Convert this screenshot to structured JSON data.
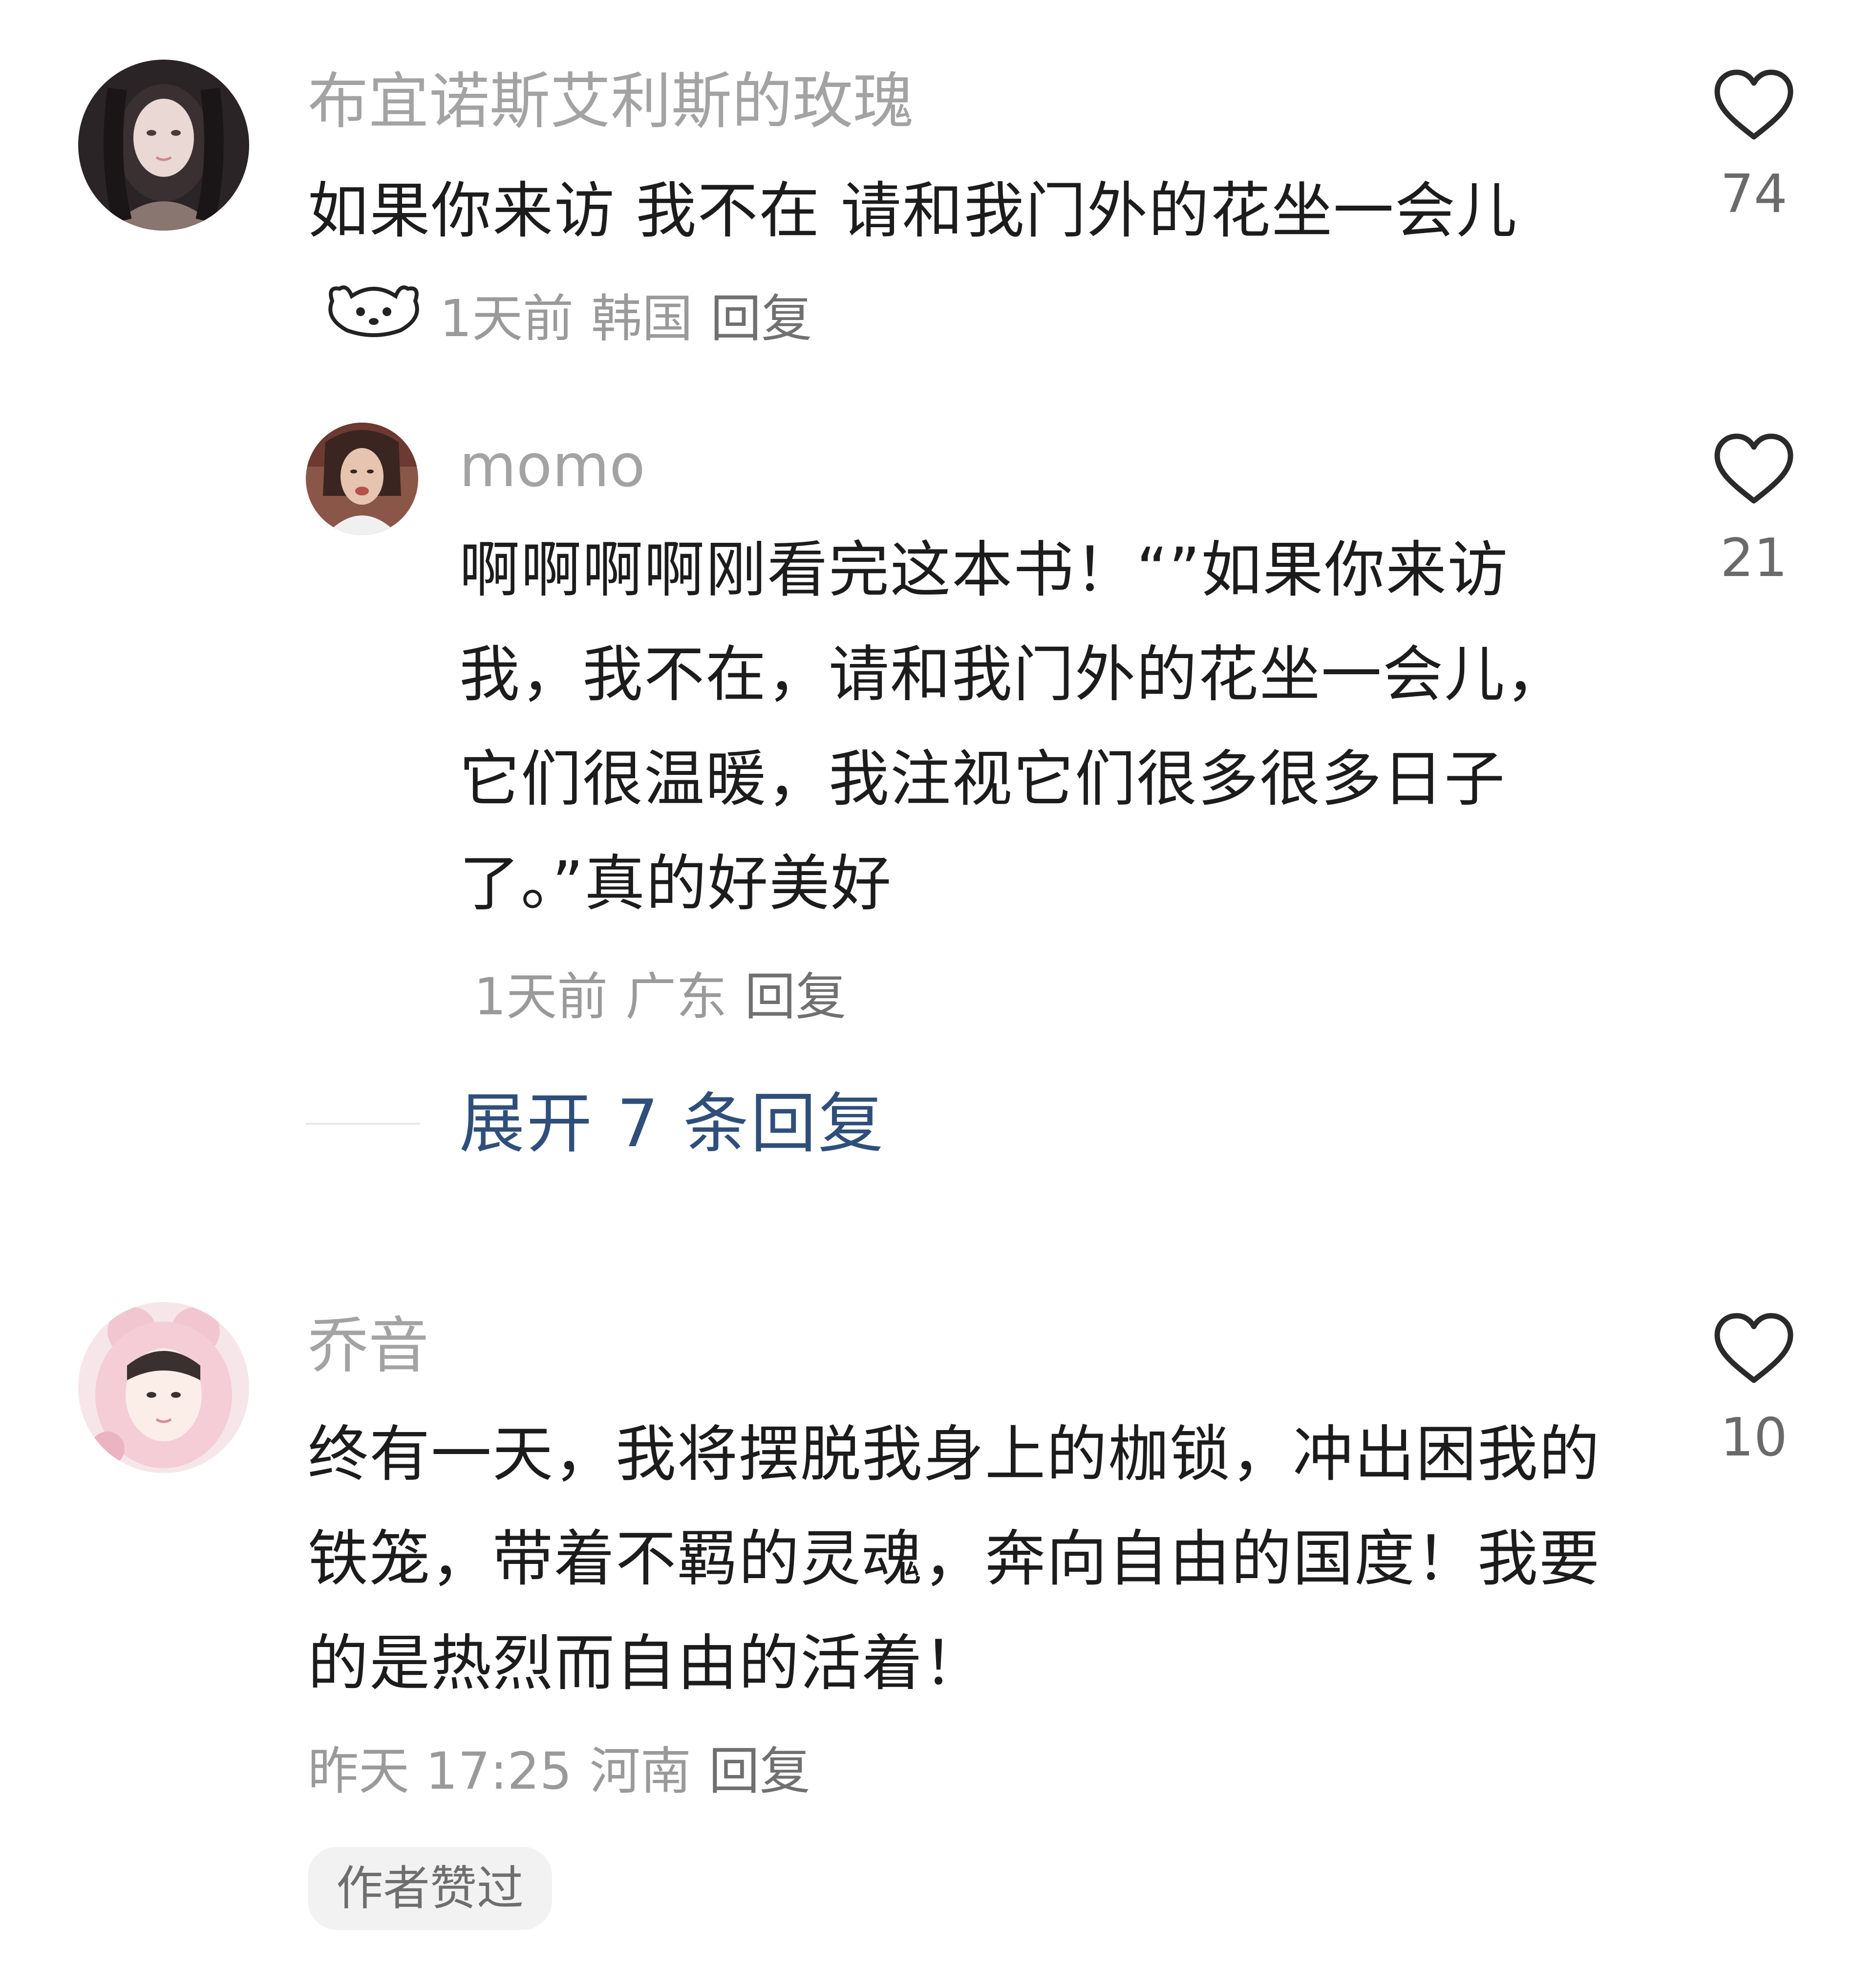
{
  "comments": [
    {
      "username": "布宜诺斯艾利斯的玫瑰",
      "text": "如果你来访 我不在 请和我门外的花坐一会儿",
      "emoji_icon": "bear-face-emoji",
      "time": "1天前",
      "location": "韩国",
      "reply_label": "回复",
      "likes": "74"
    },
    {
      "username": "momo",
      "text": "啊啊啊啊刚看完这本书！“”如果你来访我，我不在，请和我门外的花坐一会儿，它们很温暖，我注视它们很多很多日子了。”真的好美好",
      "time": "1天前",
      "location": "广东",
      "reply_label": "回复",
      "likes": "21"
    },
    {
      "username": "乔音",
      "text": "终有一天，我将摆脱我身上的枷锁，冲出困我的铁笼，带着不羁的灵魂，奔向自由的国度！我要的是热烈而自由的活着！",
      "time": "昨天 17:25",
      "location": "河南",
      "reply_label": "回复",
      "likes": "10",
      "author_badge": "作者赞过"
    }
  ],
  "expand_replies": "展开 7 条回复",
  "colors": {
    "username": "#a3a3a3",
    "body": "#1c1c1c",
    "meta": "#9a9a9a",
    "expand_link": "#2f4f7a",
    "badge_bg": "#f2f2f2"
  }
}
